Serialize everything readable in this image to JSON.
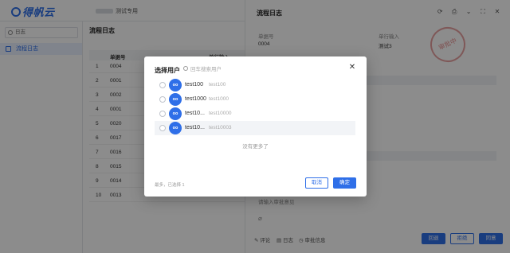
{
  "app": {
    "logo_text": "得帆云",
    "tenant": "测试专用"
  },
  "sidebar": {
    "search_value": "日志",
    "items": [
      {
        "label": "流程日志"
      }
    ]
  },
  "main": {
    "title": "流程日志",
    "columns": [
      "单据号",
      "单行输入"
    ],
    "rows": [
      {
        "index": "1",
        "bill_no": "0004"
      },
      {
        "index": "2",
        "bill_no": "0001"
      },
      {
        "index": "3",
        "bill_no": "0002"
      },
      {
        "index": "4",
        "bill_no": "0001"
      },
      {
        "index": "5",
        "bill_no": "0020"
      },
      {
        "index": "6",
        "bill_no": "0017"
      },
      {
        "index": "7",
        "bill_no": "0016"
      },
      {
        "index": "8",
        "bill_no": "0015"
      },
      {
        "index": "9",
        "bill_no": "0014"
      },
      {
        "index": "10",
        "bill_no": "0013"
      }
    ]
  },
  "drawer": {
    "title": "流程日志",
    "fields": [
      {
        "label": "单据号",
        "value": "0004"
      },
      {
        "label": "单行输入",
        "value": "测试3"
      }
    ],
    "stamp": "审批中",
    "comment_placeholder": "请输入审批意见",
    "footer_links": [
      "评论",
      "日志",
      "审批信息"
    ],
    "footer_buttons": [
      "回退",
      "拒绝",
      "同意"
    ]
  },
  "modal": {
    "title": "选择用户",
    "search_placeholder": "回车搜索用户",
    "users": [
      {
        "avatar": "oo",
        "name": "test100",
        "account": "test100"
      },
      {
        "avatar": "oo",
        "name": "test1000",
        "account": "test1000"
      },
      {
        "avatar": "oo",
        "name": "test10...",
        "account": "test10000"
      },
      {
        "avatar": "oo",
        "name": "test10...",
        "account": "test10003"
      }
    ],
    "no_more_text": "没有更多了",
    "selected_count": "最多，已选择 1",
    "cancel_label": "取消",
    "ok_label": "确定"
  },
  "colors": {
    "primary": "#2f6fe8",
    "mask": "rgba(0,0,0,0.45)"
  }
}
